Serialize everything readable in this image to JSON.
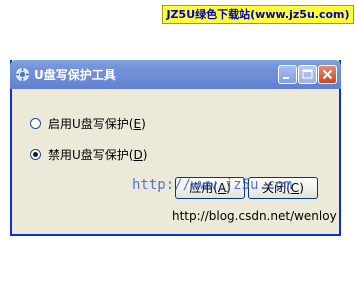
{
  "watermark": {
    "text": "JZ5U绿色下载站(www.jz5u.com)"
  },
  "window": {
    "title": "U盘写保护工具",
    "controls": {
      "minimize": "minimize",
      "maximize": "maximize",
      "close": "close"
    }
  },
  "options": [
    {
      "label_pre": "启用U盘写保护(",
      "hotkey": "E",
      "label_post": ")",
      "checked": false
    },
    {
      "label_pre": "禁用U盘写保护(",
      "hotkey": "D",
      "label_post": ")",
      "checked": true
    }
  ],
  "buttons": {
    "apply": {
      "pre": "应用(",
      "hotkey": "A",
      "post": ")"
    },
    "close": {
      "pre": "关闭(",
      "hotkey": "C",
      "post": ")"
    }
  },
  "overlay_url": "http://www.jz5u.com",
  "footer_link": "http://blog.csdn.net/wenloy",
  "colors": {
    "titlebar": "#6f8ed8",
    "window_bg": "#ece9d8",
    "border": "#0831d9"
  }
}
